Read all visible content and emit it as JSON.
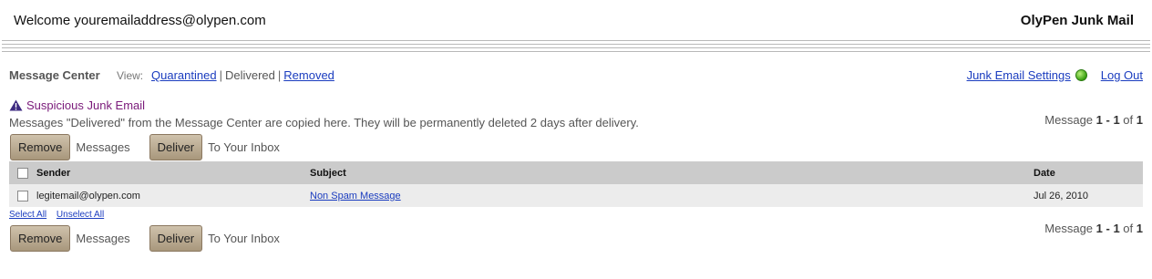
{
  "header": {
    "welcome": "Welcome youremailaddress@olypen.com",
    "brand": "OlyPen Junk Mail"
  },
  "toolbar": {
    "message_center": "Message Center",
    "view_label": "View:",
    "view_links": [
      "Quarantined",
      "Delivered",
      "Removed"
    ],
    "separator": "|",
    "settings_link": "Junk Email Settings",
    "logout_link": "Log Out",
    "status_color": "#3aa012"
  },
  "notice": {
    "title": "Suspicious Junk Email",
    "icon": "warning-triangle-icon",
    "description": "Messages \"Delivered\" from the Message Center are copied here. They will be permanently deleted 2 days after delivery."
  },
  "actions": {
    "remove_label": "Remove",
    "remove_suffix": "Messages",
    "deliver_label": "Deliver",
    "deliver_suffix": "To Your Inbox"
  },
  "pagination": {
    "prefix": "Message",
    "range": "1 - 1",
    "of": "of",
    "total": "1"
  },
  "table": {
    "columns": [
      "Sender",
      "Subject",
      "Date"
    ],
    "rows": [
      {
        "sender": "legitemail@olypen.com",
        "subject": "Non Spam Message",
        "date": "Jul 26, 2010"
      }
    ]
  },
  "selection": {
    "select_all": "Select All",
    "unselect_all": "Unselect All"
  },
  "colors": {
    "button_top": "#cfc2ac",
    "button_bottom": "#a8977c",
    "link": "#1a3cbf",
    "alert": "#7a1a7a",
    "header_row": "#cbcbcb",
    "data_row": "#ececec"
  }
}
